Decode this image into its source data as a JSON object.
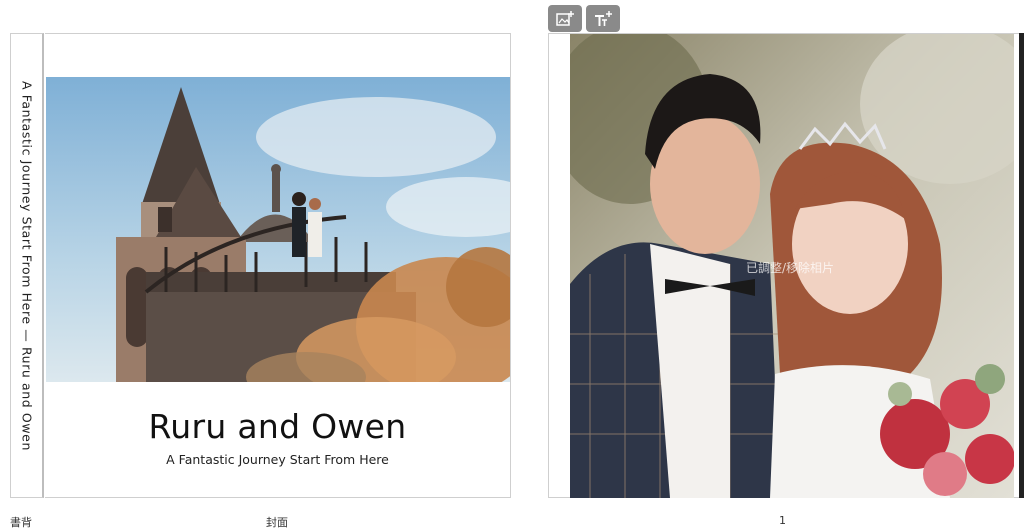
{
  "spine": {
    "text": "A Fantastic Journey Start From Here — Ruru and Owen",
    "caption": "書背"
  },
  "cover": {
    "title": "Ruru and Owen",
    "subtitle": "A Fantastic Journey Start From Here",
    "caption": "封面",
    "photo_icon": "castle-wedding-photo"
  },
  "page1": {
    "caption": "1",
    "watermark": "已調整/移除相片",
    "photo_icon": "couple-portrait-photo"
  },
  "toolbar": {
    "add_image_icon": "add-image-icon",
    "add_text_icon": "add-text-icon"
  },
  "colors": {
    "toolbar_button": "#8a8a8a",
    "border": "#cfcfcf",
    "sky": "#9ec3dd"
  }
}
